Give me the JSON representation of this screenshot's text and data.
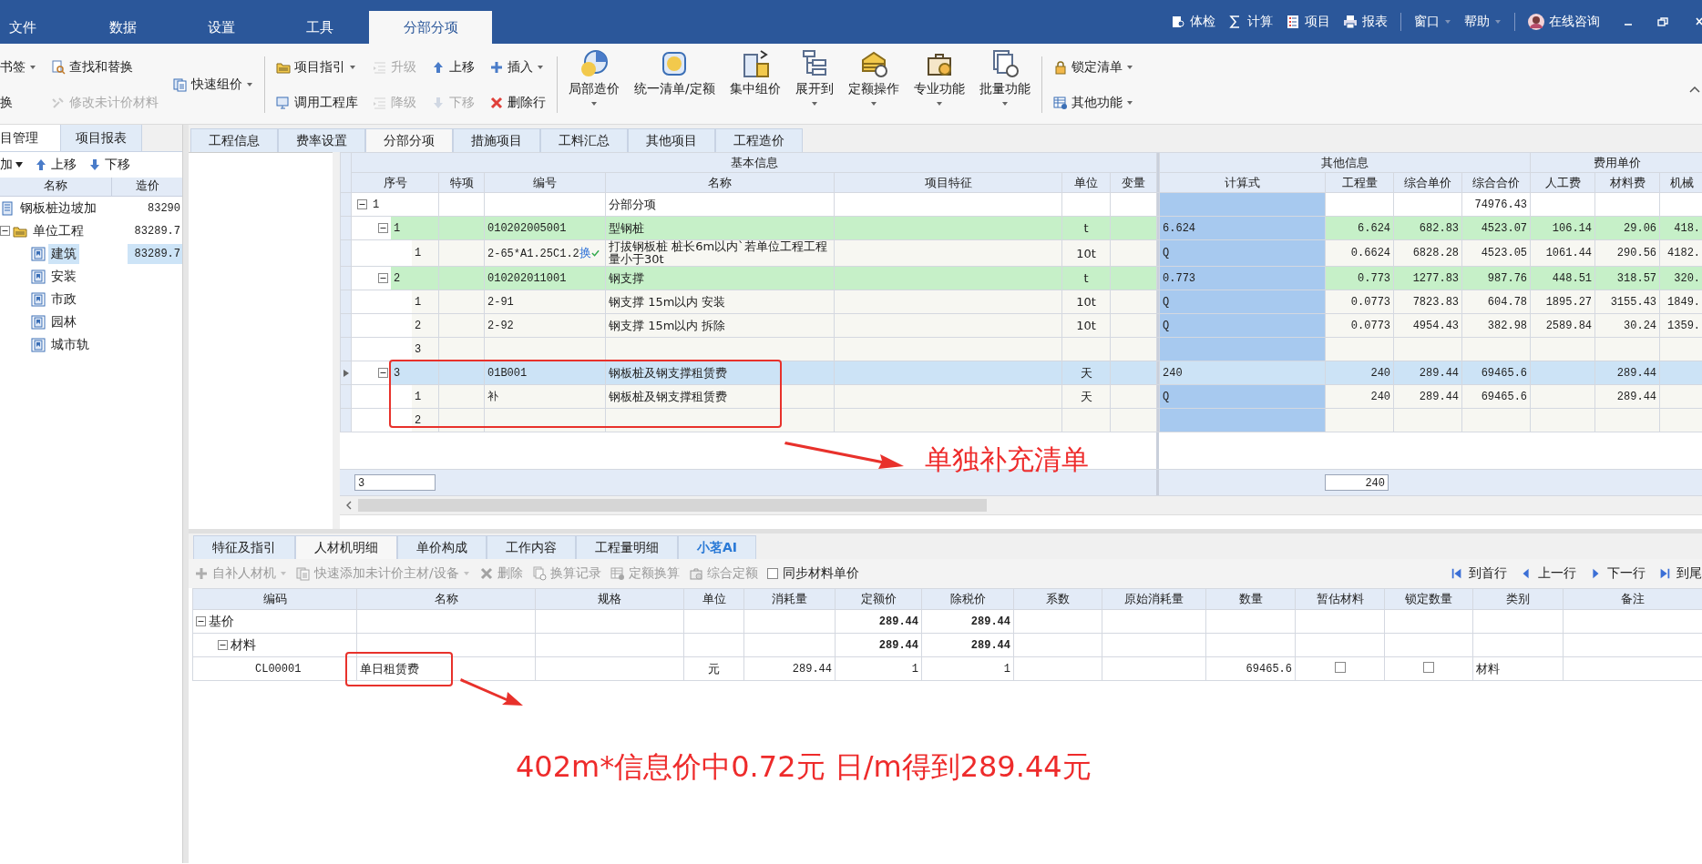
{
  "menu": {
    "tabs": [
      {
        "label": "文件",
        "selected": false
      },
      {
        "label": "数据",
        "selected": false
      },
      {
        "label": "设置",
        "selected": false
      },
      {
        "label": "工具",
        "selected": false
      },
      {
        "label": "分部分项",
        "selected": true
      }
    ],
    "tools": [
      {
        "label": "体检",
        "kind": "button"
      },
      {
        "label": "计算",
        "kind": "button"
      },
      {
        "label": "项目",
        "kind": "button"
      },
      {
        "label": "报表",
        "kind": "button"
      },
      {
        "label": "窗口",
        "kind": "menu"
      },
      {
        "label": "帮助",
        "kind": "menu"
      },
      {
        "label": "在线咨询",
        "kind": "consult"
      }
    ]
  },
  "ribbon": {
    "groups": [
      {
        "columns": [
          {
            "kind": "stack",
            "buttons": [
              {
                "label": "书签",
                "dropdown": true,
                "disabled": false
              },
              {
                "label": "换",
                "dropdown": false,
                "disabled": false
              }
            ]
          },
          {
            "kind": "stack",
            "buttons": [
              {
                "label": "查找和替换",
                "dropdown": false,
                "disabled": false
              },
              {
                "label": "修改未计价材料",
                "dropdown": false,
                "disabled": true
              }
            ]
          },
          {
            "kind": "stack",
            "buttons": [
              {
                "label": "快速组价",
                "dropdown": true,
                "disabled": false
              }
            ]
          }
        ]
      },
      {
        "columns": [
          {
            "kind": "stack",
            "buttons": [
              {
                "label": "项目指引",
                "dropdown": true,
                "disabled": false
              },
              {
                "label": "调用工程库",
                "dropdown": false,
                "disabled": false
              }
            ]
          },
          {
            "kind": "stack",
            "buttons": [
              {
                "label": "升级",
                "dropdown": false,
                "disabled": true
              },
              {
                "label": "降级",
                "dropdown": false,
                "disabled": true
              }
            ]
          },
          {
            "kind": "stack",
            "buttons": [
              {
                "label": "上移",
                "dropdown": false,
                "disabled": false
              },
              {
                "label": "下移",
                "dropdown": false,
                "disabled": true
              }
            ]
          },
          {
            "kind": "stack",
            "buttons": [
              {
                "label": "插入",
                "dropdown": true,
                "disabled": false
              },
              {
                "label": "删除行",
                "dropdown": false,
                "disabled": false
              }
            ]
          }
        ]
      },
      {
        "columns": [
          {
            "kind": "large",
            "label": "局部造价",
            "dropdown": true
          },
          {
            "kind": "large",
            "label": "统一清单/定额",
            "dropdown": false
          },
          {
            "kind": "large",
            "label": "集中组价",
            "dropdown": false
          },
          {
            "kind": "large",
            "label": "展开到",
            "dropdown": true
          },
          {
            "kind": "large",
            "label": "定额操作",
            "dropdown": true
          },
          {
            "kind": "large",
            "label": "专业功能",
            "dropdown": true
          },
          {
            "kind": "large",
            "label": "批量功能",
            "dropdown": true
          }
        ]
      },
      {
        "columns": [
          {
            "kind": "stack",
            "buttons": [
              {
                "label": "锁定清单",
                "dropdown": true,
                "disabled": false
              },
              {
                "label": "其他功能",
                "dropdown": true,
                "disabled": false
              }
            ]
          }
        ]
      }
    ]
  },
  "left_panel": {
    "tabs": [
      {
        "label": "目管理",
        "selected": true
      },
      {
        "label": "项目报表",
        "selected": false
      }
    ],
    "toolbar": [
      {
        "label": "加",
        "dropdown": true
      },
      {
        "label": "上移",
        "dropdown": false
      },
      {
        "label": "下移",
        "dropdown": false
      }
    ],
    "columns": [
      "名称",
      "造价"
    ],
    "tree": [
      {
        "label": "钢板桩边坡加",
        "cost": "83290",
        "kind": "project",
        "selected": false
      },
      {
        "label": "单位工程",
        "cost": "83289.7",
        "kind": "folder",
        "selected": false,
        "expanded": true,
        "children": [
          {
            "label": "建筑",
            "cost": "83289.7",
            "kind": "item",
            "selected": true
          },
          {
            "label": "安装",
            "kind": "item",
            "selected": false
          },
          {
            "label": "市政",
            "kind": "item",
            "selected": false
          },
          {
            "label": "园林",
            "kind": "item",
            "selected": false
          },
          {
            "label": "城市轨",
            "kind": "item",
            "selected": false
          }
        ]
      }
    ]
  },
  "main_tabs": [
    {
      "label": "工程信息",
      "selected": false
    },
    {
      "label": "费率设置",
      "selected": false
    },
    {
      "label": "分部分项",
      "selected": true
    },
    {
      "label": "措施项目",
      "selected": false
    },
    {
      "label": "工料汇总",
      "selected": false
    },
    {
      "label": "其他项目",
      "selected": false
    },
    {
      "label": "工程造价",
      "selected": false
    }
  ],
  "grid": {
    "group_headers": [
      "基本信息",
      "其他信息",
      "费用单价"
    ],
    "columns": [
      "序号",
      "特项",
      "编号",
      "名称",
      "项目特征",
      "单位",
      "变量",
      "计算式",
      "工程量",
      "综合单价",
      "综合合价",
      "人工费",
      "材料费",
      "机械"
    ],
    "rows": [
      {
        "kind": "division",
        "seq": "1",
        "name": "分部分项",
        "total": "74976.43",
        "expanded": true,
        "selected": false,
        "children": [
          {
            "kind": "bill",
            "seq": "1",
            "code": "010202005001",
            "name": "型钢桩",
            "unit": "t",
            "formula": "6.624",
            "qty": "6.624",
            "unit_price": "682.83",
            "total": "4523.07",
            "labor": "106.14",
            "material": "29.06",
            "machine": "418.",
            "expanded": true,
            "selected": false,
            "children": [
              {
                "kind": "quota",
                "seq": "1",
                "code": "2-65*A1.25C1.2",
                "badge": "换",
                "name": "打拔钢板桩 桩长6m以内`若单位工程工程量小于30t",
                "unit": "10t",
                "formula": "Q",
                "qty": "0.6624",
                "unit_price": "6828.28",
                "total": "4523.05",
                "labor": "1061.44",
                "material": "290.56",
                "machine": "4182.",
                "selected": false
              }
            ]
          },
          {
            "kind": "bill",
            "seq": "2",
            "code": "010202011001",
            "name": "钢支撑",
            "unit": "t",
            "formula": "0.773",
            "qty": "0.773",
            "unit_price": "1277.83",
            "total": "987.76",
            "labor": "448.51",
            "material": "318.57",
            "machine": "320.",
            "expanded": true,
            "selected": false,
            "children": [
              {
                "kind": "quota",
                "seq": "1",
                "code": "2-91",
                "name": "钢支撑 15m以内 安装",
                "unit": "10t",
                "formula": "Q",
                "qty": "0.0773",
                "unit_price": "7823.83",
                "total": "604.78",
                "labor": "1895.27",
                "material": "3155.43",
                "machine": "1849.",
                "selected": false
              },
              {
                "kind": "quota",
                "seq": "2",
                "code": "2-92",
                "name": "钢支撑 15m以内 拆除",
                "unit": "10t",
                "formula": "Q",
                "qty": "0.0773",
                "unit_price": "4954.43",
                "total": "382.98",
                "labor": "2589.84",
                "material": "30.24",
                "machine": "1359.",
                "selected": false
              },
              {
                "kind": "quota",
                "seq": "3",
                "selected": false
              }
            ]
          },
          {
            "kind": "bill",
            "seq": "3",
            "code": "01B001",
            "name": "钢板桩及钢支撑租赁费",
            "unit": "天",
            "formula": "240",
            "qty": "240",
            "unit_price": "289.44",
            "total": "69465.6",
            "material": "289.44",
            "expanded": true,
            "selected": true,
            "children": [
              {
                "kind": "quota",
                "seq": "1",
                "code": "补",
                "name": "钢板桩及钢支撑租赁费",
                "unit": "天",
                "formula": "Q",
                "qty": "240",
                "unit_price": "289.44",
                "total": "69465.6",
                "material": "289.44",
                "selected": false
              },
              {
                "kind": "quota",
                "seq": "2",
                "selected": false
              }
            ]
          }
        ]
      }
    ],
    "footer": {
      "seq_field": "3",
      "qty_field": "240"
    }
  },
  "annotations": [
    {
      "text": "单独补充清单"
    },
    {
      "text": "402m*信息价中0.72元 日/m得到289.44元"
    }
  ],
  "bottom": {
    "tabs": [
      {
        "label": "特征及指引",
        "selected": false,
        "kind": "normal"
      },
      {
        "label": "人材机明细",
        "selected": true,
        "kind": "normal"
      },
      {
        "label": "单价构成",
        "selected": false,
        "kind": "normal"
      },
      {
        "label": "工作内容",
        "selected": false,
        "kind": "normal"
      },
      {
        "label": "工程量明细",
        "selected": false,
        "kind": "normal"
      },
      {
        "label": "小茗AI",
        "selected": false,
        "kind": "ai"
      }
    ],
    "toolbar": [
      {
        "label": "自补人材机",
        "dropdown": true,
        "disabled": true
      },
      {
        "label": "快速添加未计价主材/设备",
        "dropdown": true,
        "disabled": true
      },
      {
        "label": "删除",
        "dropdown": false,
        "disabled": true
      },
      {
        "label": "换算记录",
        "dropdown": false,
        "disabled": true
      },
      {
        "label": "定额换算",
        "dropdown": false,
        "disabled": true
      },
      {
        "label": "综合定额",
        "dropdown": false,
        "disabled": true
      }
    ],
    "sync_checkbox": {
      "label": "同步材料单价",
      "checked": false
    },
    "nav": [
      {
        "label": "到首行"
      },
      {
        "label": "上一行"
      },
      {
        "label": "下一行"
      },
      {
        "label": "到尾"
      }
    ],
    "columns": [
      "编码",
      "名称",
      "规格",
      "单位",
      "消耗量",
      "定额价",
      "除税价",
      "系数",
      "原始消耗量",
      "数量",
      "暂估材料",
      "锁定数量",
      "类别",
      "备注"
    ],
    "rows": [
      {
        "kind": "group",
        "code": "基价",
        "quota_price": "289.44",
        "tax_excl_price": "289.44",
        "expanded": true,
        "children": [
          {
            "kind": "group",
            "code": "材料",
            "quota_price": "289.44",
            "tax_excl_price": "289.44",
            "expanded": true,
            "children": [
              {
                "kind": "item",
                "code": "CL00001",
                "name": "单日租赁费",
                "unit": "元",
                "consumption": "289.44",
                "quota_price": "1",
                "tax_excl_price": "1",
                "quantity": "69465.6",
                "provisional": false,
                "locked": false,
                "category": "材料"
              }
            ]
          }
        ]
      }
    ]
  }
}
